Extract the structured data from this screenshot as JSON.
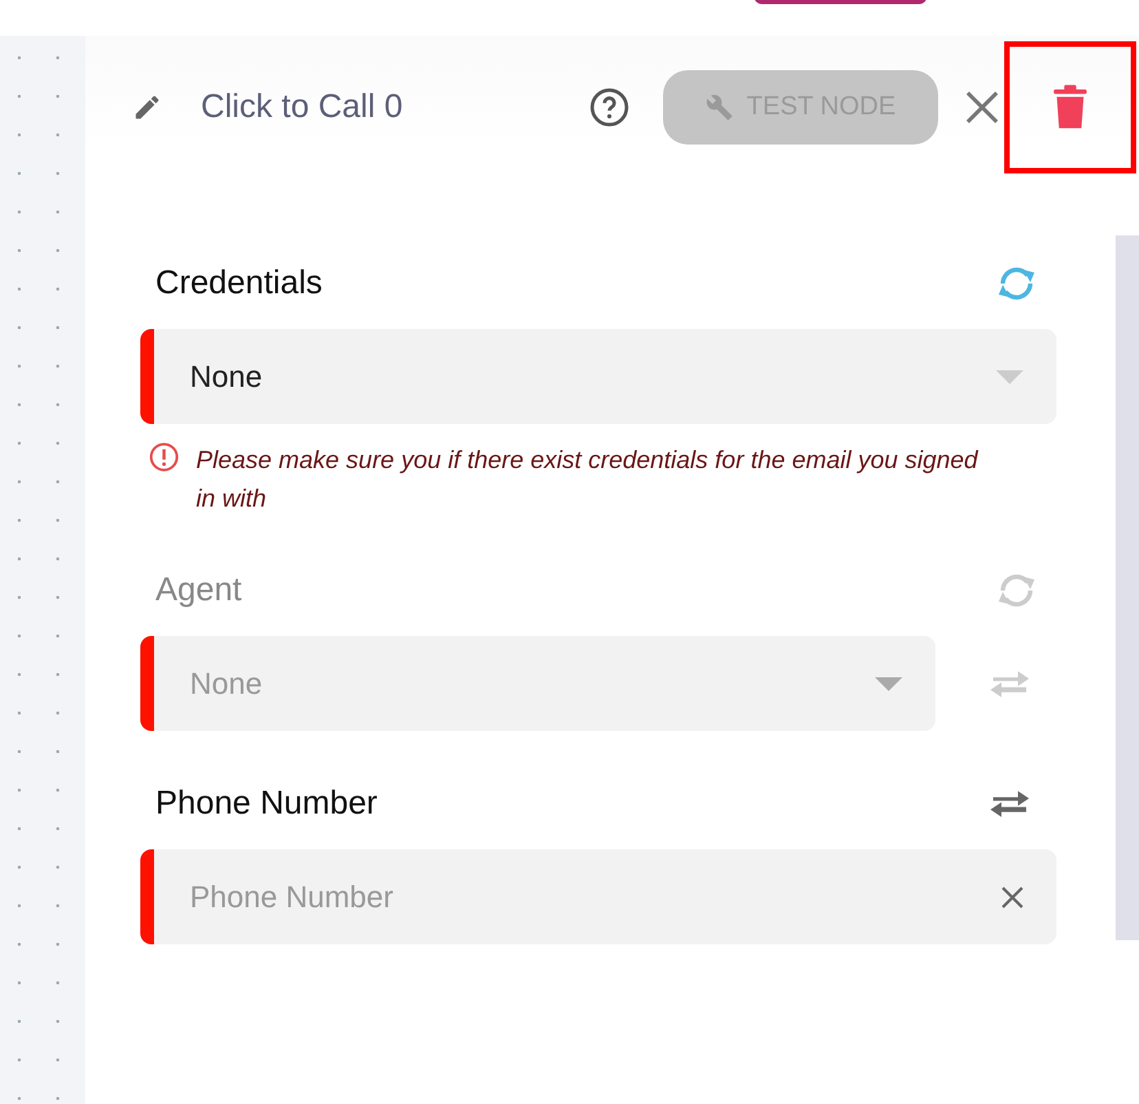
{
  "header": {
    "title": "Click to Call 0",
    "test_button": {
      "label": "TEST NODE",
      "disabled": true
    },
    "delete_highlighted": true
  },
  "fields": [
    {
      "kind": "select",
      "label": "Credentials",
      "disabled": false,
      "refreshable": true,
      "mappable": false,
      "required": true,
      "value": "None",
      "error": "Please make sure you if there exist credentials for the email you signed in with"
    },
    {
      "kind": "select",
      "label": "Agent",
      "disabled": true,
      "refreshable": true,
      "mappable": true,
      "required": true,
      "value": "None"
    },
    {
      "kind": "input",
      "label": "Phone Number",
      "disabled": false,
      "refreshable": false,
      "mappable": true,
      "required": true,
      "placeholder": "Phone Number"
    }
  ]
}
